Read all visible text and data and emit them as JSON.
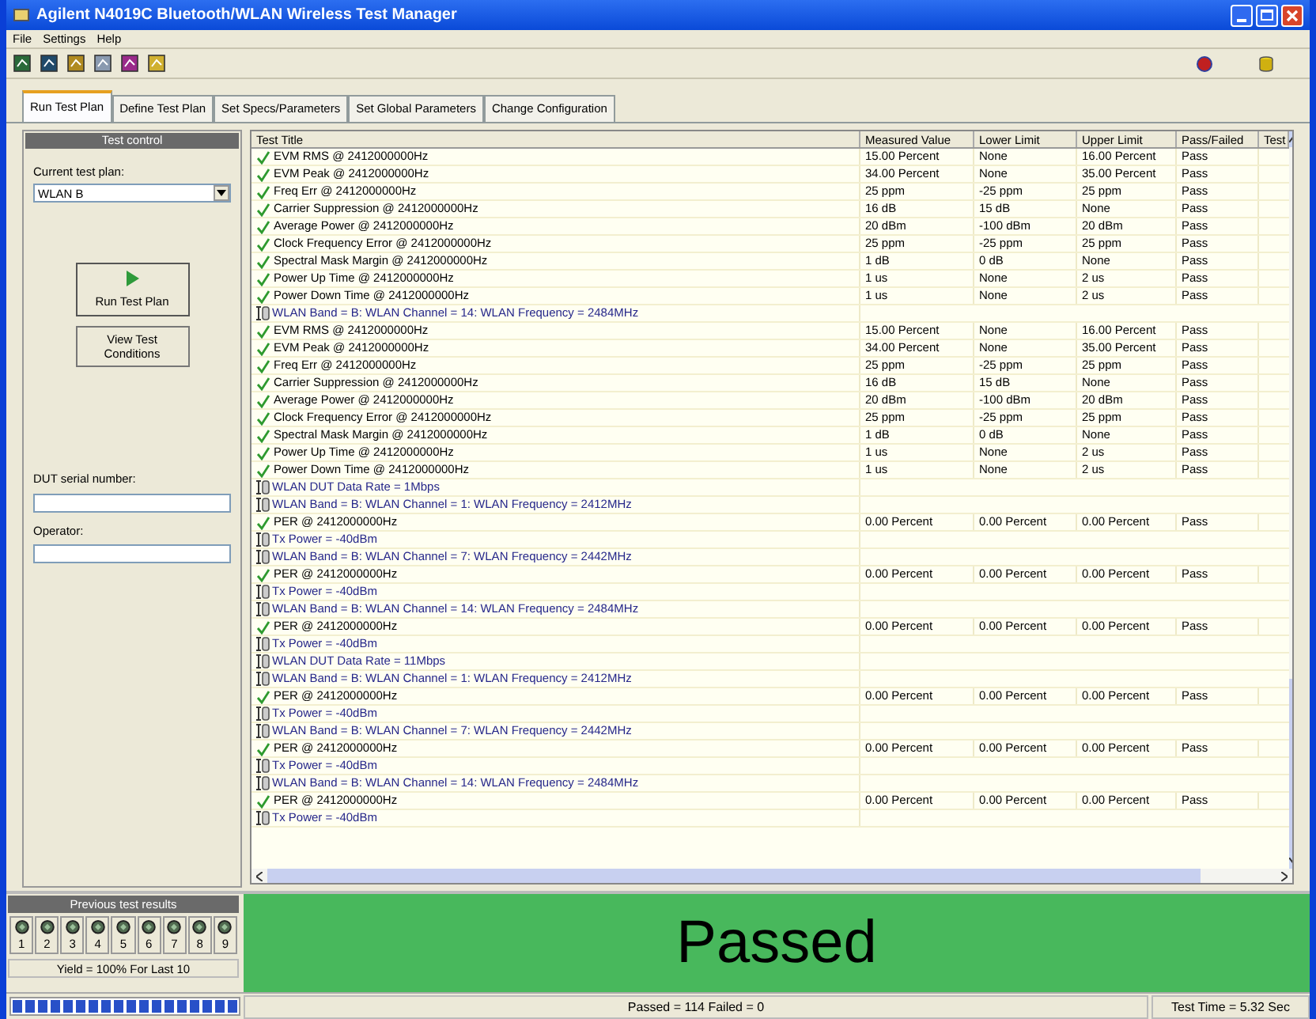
{
  "window": {
    "title": "Agilent N4019C Bluetooth/WLAN Wireless Test Manager"
  },
  "menu": [
    "File",
    "Settings",
    "Help"
  ],
  "tabs": [
    {
      "label": "Run Test Plan",
      "selected": true
    },
    {
      "label": "Define Test Plan",
      "selected": false
    },
    {
      "label": "Set Specs/Parameters",
      "selected": false
    },
    {
      "label": "Set Global Parameters",
      "selected": false
    },
    {
      "label": "Change Configuration",
      "selected": false
    }
  ],
  "test_control": {
    "title": "Test control",
    "plan_label": "Current test plan:",
    "plan_value": "WLAN B",
    "run_button": "Run Test Plan",
    "view_button": "View Test Conditions",
    "serial_label": "DUT serial number:",
    "operator_label": "Operator:"
  },
  "table": {
    "columns": [
      "Test Title",
      "Measured Value",
      "Lower Limit",
      "Upper Limit",
      "Pass/Failed",
      "Test"
    ],
    "rows": [
      {
        "kind": "test",
        "passed": true,
        "cells": [
          "EVM RMS @ 2412000000Hz",
          "15.00 Percent",
          "None",
          "16.00 Percent",
          "Pass"
        ]
      },
      {
        "kind": "test",
        "passed": true,
        "cells": [
          "EVM Peak @ 2412000000Hz",
          "34.00 Percent",
          "None",
          "35.00 Percent",
          "Pass"
        ]
      },
      {
        "kind": "test",
        "passed": true,
        "cells": [
          "Freq Err @ 2412000000Hz",
          "25 ppm",
          "-25 ppm",
          "25 ppm",
          "Pass"
        ]
      },
      {
        "kind": "test",
        "passed": true,
        "cells": [
          "Carrier Suppression @ 2412000000Hz",
          "16 dB",
          "15 dB",
          "None",
          "Pass"
        ]
      },
      {
        "kind": "test",
        "passed": true,
        "cells": [
          "Average Power  @ 2412000000Hz",
          "20 dBm",
          "-100 dBm",
          "20 dBm",
          "Pass"
        ]
      },
      {
        "kind": "test",
        "passed": true,
        "cells": [
          "Clock Frequency Error @ 2412000000Hz",
          "25 ppm",
          "-25 ppm",
          "25 ppm",
          "Pass"
        ]
      },
      {
        "kind": "test",
        "passed": true,
        "cells": [
          "Spectral Mask Margin @ 2412000000Hz",
          "1 dB",
          "0 dB",
          "None",
          "Pass"
        ]
      },
      {
        "kind": "test",
        "passed": true,
        "cells": [
          "Power Up Time @ 2412000000Hz",
          "1 us",
          "None",
          "2 us",
          "Pass"
        ]
      },
      {
        "kind": "test",
        "passed": true,
        "cells": [
          "Power Down Time @ 2412000000Hz",
          "1 us",
          "None",
          "2 us",
          "Pass"
        ]
      },
      {
        "kind": "condition",
        "cells": [
          "WLAN Band = B: WLAN Channel = 14: WLAN Frequency = 2484MHz"
        ]
      },
      {
        "kind": "test",
        "passed": true,
        "cells": [
          "EVM RMS @ 2412000000Hz",
          "15.00 Percent",
          "None",
          "16.00 Percent",
          "Pass"
        ]
      },
      {
        "kind": "test",
        "passed": true,
        "cells": [
          "EVM Peak @ 2412000000Hz",
          "34.00 Percent",
          "None",
          "35.00 Percent",
          "Pass"
        ]
      },
      {
        "kind": "test",
        "passed": true,
        "cells": [
          "Freq Err @ 2412000000Hz",
          "25 ppm",
          "-25 ppm",
          "25 ppm",
          "Pass"
        ]
      },
      {
        "kind": "test",
        "passed": true,
        "cells": [
          "Carrier Suppression @ 2412000000Hz",
          "16 dB",
          "15 dB",
          "None",
          "Pass"
        ]
      },
      {
        "kind": "test",
        "passed": true,
        "cells": [
          "Average Power  @ 2412000000Hz",
          "20 dBm",
          "-100 dBm",
          "20 dBm",
          "Pass"
        ]
      },
      {
        "kind": "test",
        "passed": true,
        "cells": [
          "Clock Frequency Error @ 2412000000Hz",
          "25 ppm",
          "-25 ppm",
          "25 ppm",
          "Pass"
        ]
      },
      {
        "kind": "test",
        "passed": true,
        "cells": [
          "Spectral Mask Margin @ 2412000000Hz",
          "1 dB",
          "0 dB",
          "None",
          "Pass"
        ]
      },
      {
        "kind": "test",
        "passed": true,
        "cells": [
          "Power Up Time @ 2412000000Hz",
          "1 us",
          "None",
          "2 us",
          "Pass"
        ]
      },
      {
        "kind": "test",
        "passed": true,
        "cells": [
          "Power Down Time @ 2412000000Hz",
          "1 us",
          "None",
          "2 us",
          "Pass"
        ]
      },
      {
        "kind": "condition",
        "cells": [
          "WLAN DUT Data Rate = 1Mbps"
        ]
      },
      {
        "kind": "condition",
        "cells": [
          "WLAN Band = B: WLAN Channel = 1: WLAN Frequency = 2412MHz"
        ]
      },
      {
        "kind": "test",
        "passed": true,
        "cells": [
          "PER @ 2412000000Hz",
          "0.00 Percent",
          "0.00 Percent",
          "0.00 Percent",
          "Pass"
        ]
      },
      {
        "kind": "condition",
        "cells": [
          "Tx Power = -40dBm"
        ]
      },
      {
        "kind": "condition",
        "cells": [
          "WLAN Band = B: WLAN Channel = 7: WLAN Frequency = 2442MHz"
        ]
      },
      {
        "kind": "test",
        "passed": true,
        "cells": [
          "PER @ 2412000000Hz",
          "0.00 Percent",
          "0.00 Percent",
          "0.00 Percent",
          "Pass"
        ]
      },
      {
        "kind": "condition",
        "cells": [
          "Tx Power = -40dBm"
        ]
      },
      {
        "kind": "condition",
        "cells": [
          "WLAN Band = B: WLAN Channel = 14: WLAN Frequency = 2484MHz"
        ]
      },
      {
        "kind": "test",
        "passed": true,
        "cells": [
          "PER @ 2412000000Hz",
          "0.00 Percent",
          "0.00 Percent",
          "0.00 Percent",
          "Pass"
        ]
      },
      {
        "kind": "condition",
        "cells": [
          "Tx Power = -40dBm"
        ]
      },
      {
        "kind": "condition",
        "cells": [
          "WLAN DUT Data Rate = 11Mbps"
        ]
      },
      {
        "kind": "condition",
        "cells": [
          "WLAN Band = B: WLAN Channel = 1: WLAN Frequency = 2412MHz"
        ]
      },
      {
        "kind": "test",
        "passed": true,
        "cells": [
          "PER @ 2412000000Hz",
          "0.00 Percent",
          "0.00 Percent",
          "0.00 Percent",
          "Pass"
        ]
      },
      {
        "kind": "condition",
        "cells": [
          "Tx Power = -40dBm"
        ]
      },
      {
        "kind": "condition",
        "cells": [
          "WLAN Band = B: WLAN Channel = 7: WLAN Frequency = 2442MHz"
        ]
      },
      {
        "kind": "test",
        "passed": true,
        "cells": [
          "PER @ 2412000000Hz",
          "0.00 Percent",
          "0.00 Percent",
          "0.00 Percent",
          "Pass"
        ]
      },
      {
        "kind": "condition",
        "cells": [
          "Tx Power = -40dBm"
        ]
      },
      {
        "kind": "condition",
        "cells": [
          "WLAN Band = B: WLAN Channel = 14: WLAN Frequency = 2484MHz"
        ]
      },
      {
        "kind": "test",
        "passed": true,
        "cells": [
          "PER @ 2412000000Hz",
          "0.00 Percent",
          "0.00 Percent",
          "0.00 Percent",
          "Pass"
        ]
      },
      {
        "kind": "condition",
        "cells": [
          "Tx Power = -40dBm"
        ]
      }
    ]
  },
  "previous_results": {
    "title": "Previous test results",
    "slots": [
      "1",
      "2",
      "3",
      "4",
      "5",
      "6",
      "7",
      "8",
      "9"
    ],
    "yield": "Yield = 100%  For Last 10"
  },
  "result": {
    "text": "Passed",
    "passed": true
  },
  "status_bar": {
    "progress": {
      "level": 1
    },
    "counts": "Passed = 114   Failed = 0",
    "time": "Test Time = 5.32 Sec"
  }
}
